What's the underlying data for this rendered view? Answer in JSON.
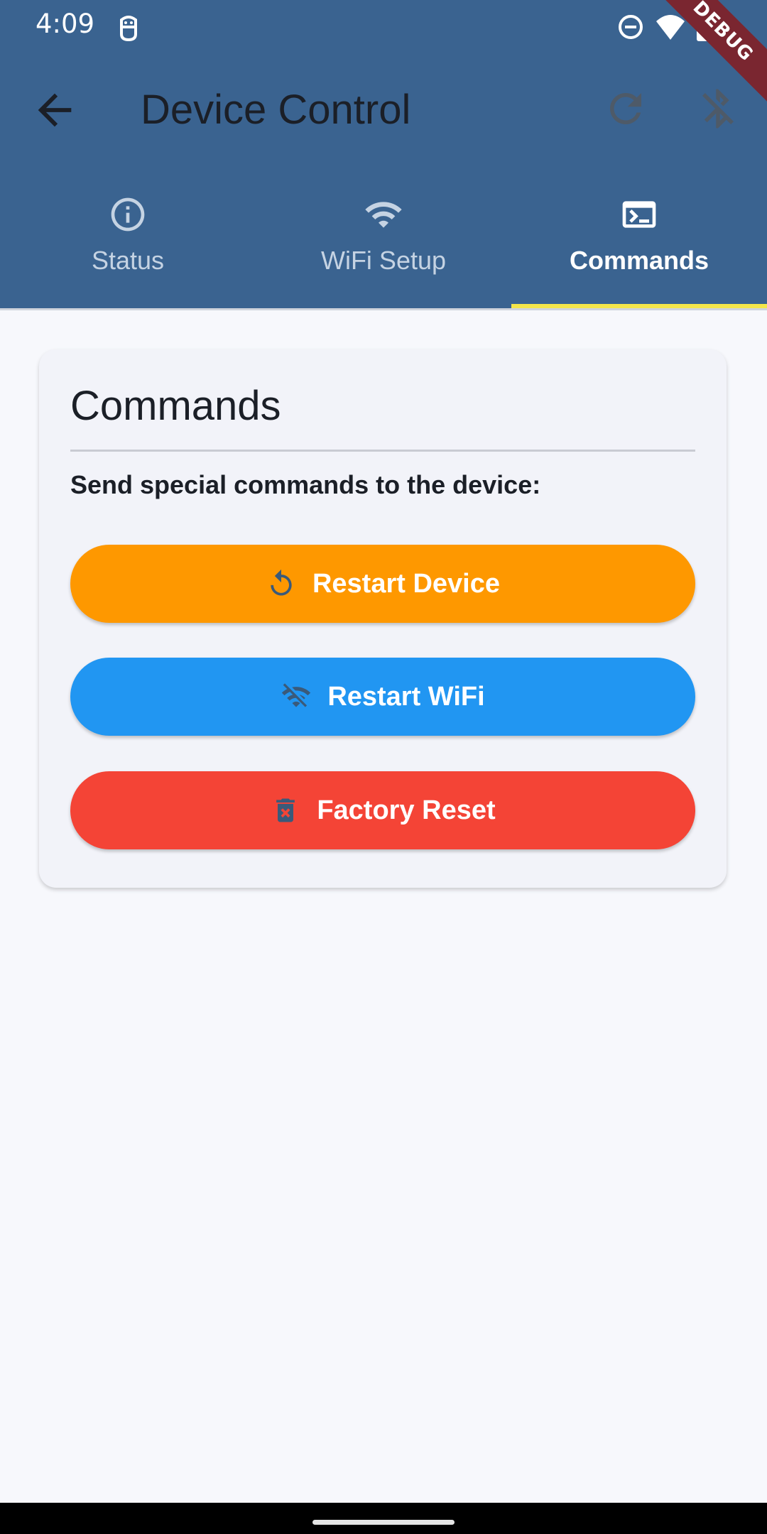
{
  "status_bar": {
    "time": "4:09",
    "debug_label": "DEBUG"
  },
  "app_bar": {
    "title": "Device Control"
  },
  "tabs": [
    {
      "label": "Status",
      "icon": "info-icon",
      "active": false
    },
    {
      "label": "WiFi Setup",
      "icon": "wifi-icon",
      "active": false
    },
    {
      "label": "Commands",
      "icon": "terminal-icon",
      "active": true
    }
  ],
  "card": {
    "title": "Commands",
    "description": "Send special commands to the device:",
    "buttons": [
      {
        "label": "Restart Device",
        "icon": "restart-icon",
        "color": "#fe9800"
      },
      {
        "label": "Restart WiFi",
        "icon": "wifi-off-icon",
        "color": "#2196f2"
      },
      {
        "label": "Factory Reset",
        "icon": "delete-forever-icon",
        "color": "#f44436"
      }
    ]
  },
  "colors": {
    "header": "#3a6390",
    "tab_indicator": "#f4e64a",
    "background": "#f7f8fc"
  }
}
